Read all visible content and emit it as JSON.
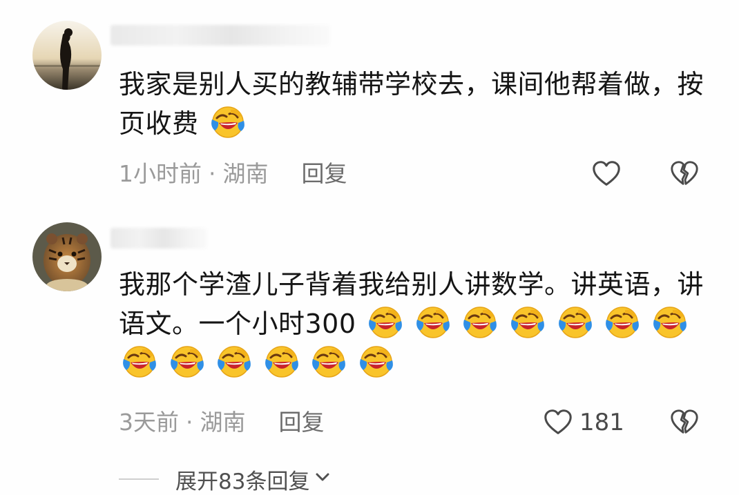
{
  "comments": [
    {
      "text": "我家是别人买的教辅带学校去，课间他帮着做，按页收费",
      "emoji_count": 1,
      "time": "1小时前",
      "location": "湖南",
      "separator": "·",
      "reply_label": "回复",
      "like_count": ""
    },
    {
      "text": "我那个学渣儿子背着我给别人讲数学。讲英语，讲语文。一个小时300",
      "emoji_count": 13,
      "time": "3天前",
      "location": "湖南",
      "separator": "·",
      "reply_label": "回复",
      "like_count": "181"
    }
  ],
  "expand_replies": {
    "label": "展开83条回复"
  },
  "icons": {
    "like": "heart-outline-icon",
    "dislike": "broken-heart-icon",
    "emoji": "rofl-crying-laughing-emoji",
    "expand": "chevron-down-icon"
  },
  "colors": {
    "text": "#151515",
    "meta": "#9a9a9a",
    "emoji_face": "#f9c42a",
    "emoji_tears": "#2f8fe6"
  }
}
